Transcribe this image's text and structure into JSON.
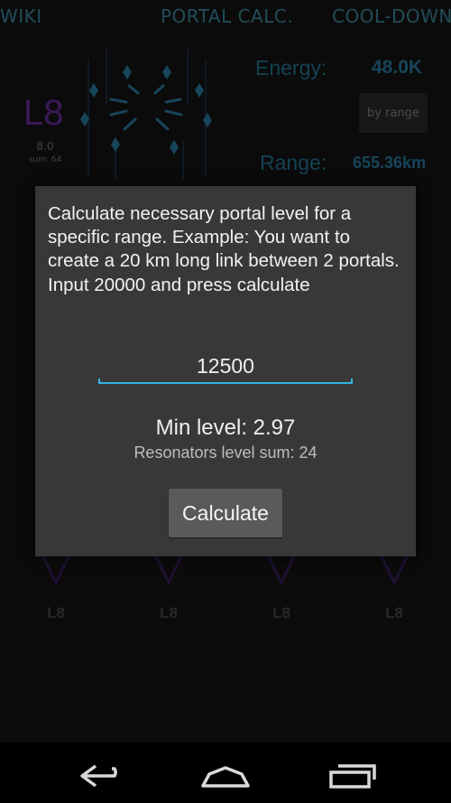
{
  "tabs": [
    "WIKI",
    "PORTAL CALC.",
    "COOL-DOWN"
  ],
  "portal": {
    "level": "L8",
    "level_value": "8.0",
    "sum": "sum: 64"
  },
  "stats": {
    "energy_label": "Energy:",
    "energy_value": "48.0K",
    "range_label": "Range:",
    "range_value": "655.36km"
  },
  "mode_button": "by range",
  "resonators": [
    "L8",
    "L8",
    "L8",
    "L8"
  ],
  "dialog": {
    "message": "Calculate necessary portal level for a specific range. Example: You want to create a 20 km long link between 2 portals. Input 20000 and press calculate",
    "input_value": "12500",
    "min_level": "Min level: 2.97",
    "resonators_sum": "Resonators level sum: 24",
    "calculate_label": "Calculate"
  },
  "navbar": {
    "buttons": [
      "back-icon",
      "home-icon",
      "recent-apps-icon"
    ]
  },
  "colors": {
    "accent": "#33b5e5",
    "tab_text": "#3f8aa0",
    "portal_purple": "#6a2fa3",
    "dialog_bg": "#383838"
  }
}
